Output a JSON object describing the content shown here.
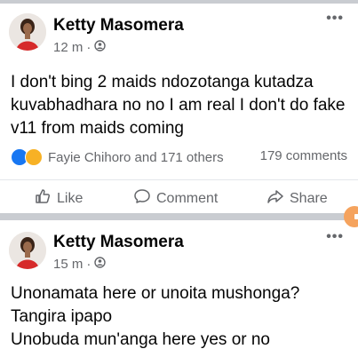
{
  "posts": [
    {
      "author": "Ketty Masomera",
      "time": "12 m",
      "privacy_icon": "friends-icon",
      "text": "I don't bing 2 maids ndozotanga kutadza kuvabhadhara no no I am real  I don't do fake v11 from maids coming",
      "reactions_text": "Fayie Chihoro and 171 others",
      "comments_text": "179 comments",
      "actions": {
        "like": "Like",
        "comment": "Comment",
        "share": "Share"
      }
    },
    {
      "author": "Ketty Masomera",
      "time": "15 m",
      "privacy_icon": "friends-icon",
      "text_lines": [
        "Unonamata here or unoita mushonga?",
        "Tangira ipapo",
        "Unobuda mun'anga here yes or no"
      ]
    }
  ],
  "colors": {
    "divider": "#c9ccd1",
    "secondary_text": "#65676b",
    "like_blue": "#1877f2",
    "haha_yellow": "#f7b125",
    "float_button": "#f5a35e"
  }
}
